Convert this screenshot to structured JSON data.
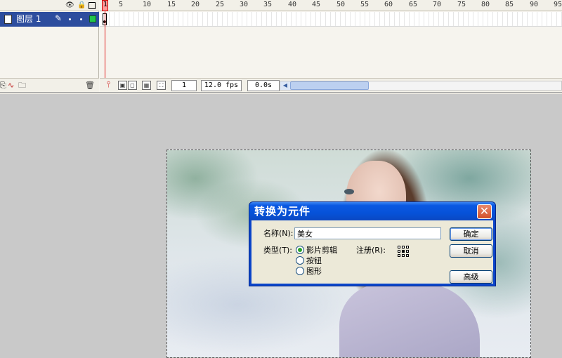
{
  "timeline": {
    "layer_name": "图层 1",
    "header_icons": [
      "eye-icon",
      "lock-icon",
      "outline-icon"
    ],
    "ruler_numbers": [
      "1",
      "5",
      "10",
      "15",
      "20",
      "25",
      "30",
      "35",
      "40",
      "45",
      "50",
      "55",
      "60",
      "65",
      "70",
      "75",
      "80",
      "85",
      "90",
      "95"
    ],
    "current_frame": "1",
    "fps": "12.0 fps",
    "elapsed_time": "0.0s",
    "colors": {
      "selected_layer": "#2d4d9e",
      "outline_color": "#22c44a",
      "playhead": "#e02020"
    }
  },
  "dialog": {
    "title": "转换为元件",
    "name_label": "名称(N):",
    "name_value": "美女",
    "type_label": "类型(T):",
    "type_options": [
      {
        "label": "影片剪辑",
        "selected": true
      },
      {
        "label": "按钮",
        "selected": false
      },
      {
        "label": "图形",
        "selected": false
      }
    ],
    "registration_label": "注册(R):",
    "ok_button": "确定",
    "cancel_button": "取消",
    "advanced_button": "高级",
    "close_symbol": "✕"
  }
}
